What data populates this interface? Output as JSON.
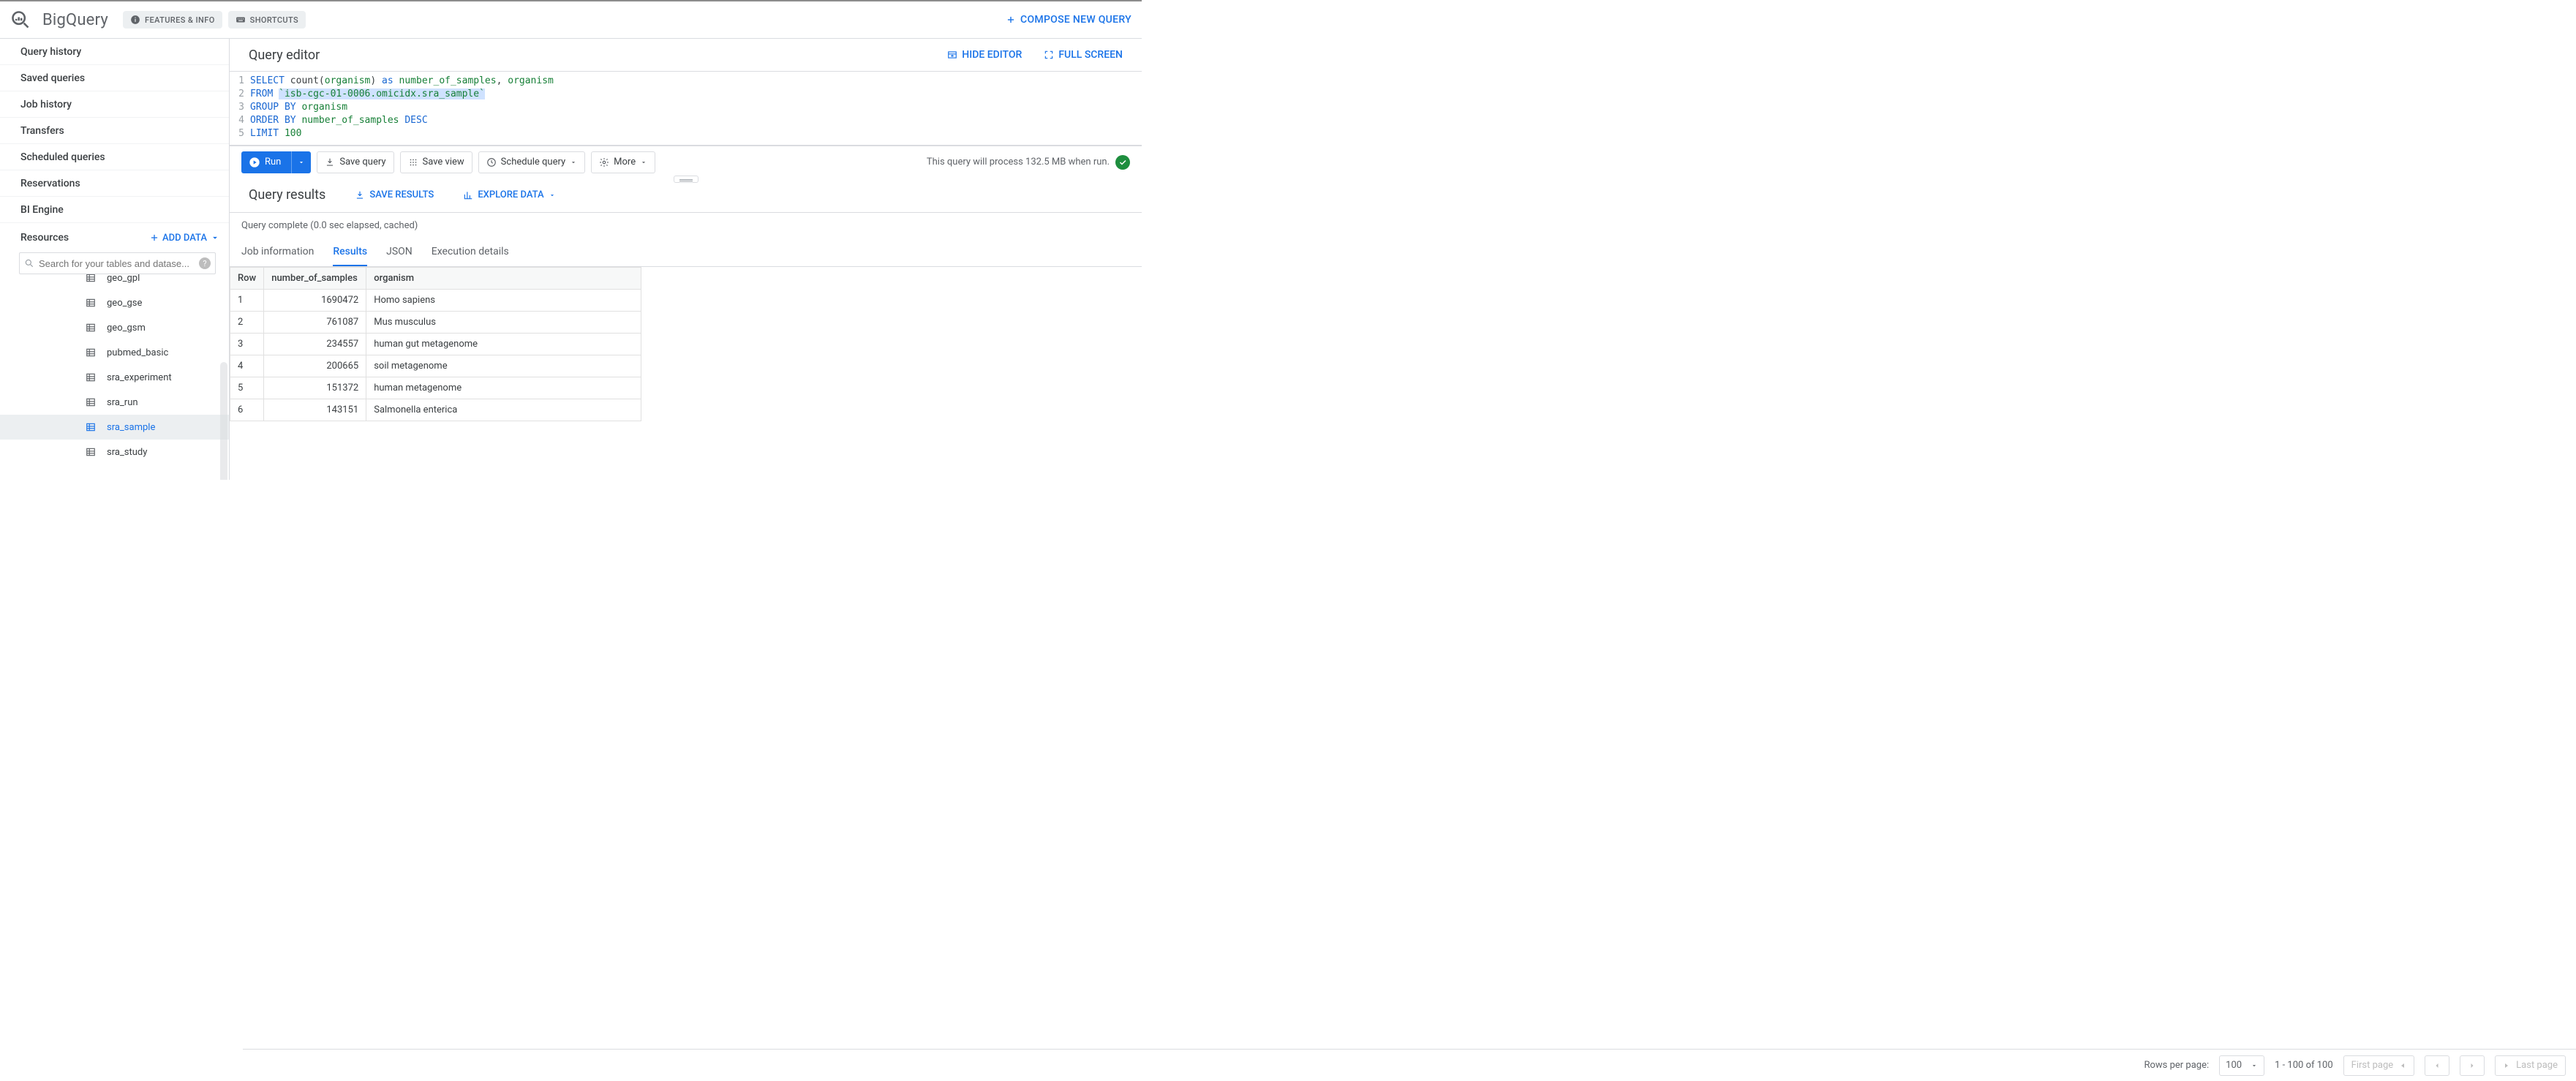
{
  "header": {
    "brand": "BigQuery",
    "features_info": "FEATURES & INFO",
    "shortcuts": "SHORTCUTS",
    "compose": "COMPOSE NEW QUERY"
  },
  "sidebar": {
    "nav": [
      "Query history",
      "Saved queries",
      "Job history",
      "Transfers",
      "Scheduled queries",
      "Reservations",
      "BI Engine"
    ],
    "resources_label": "Resources",
    "add_data": "ADD DATA",
    "search_placeholder": "Search for your tables and datase...",
    "tree_items": [
      {
        "label": "geo_gpl",
        "active": false,
        "cut": true
      },
      {
        "label": "geo_gse",
        "active": false
      },
      {
        "label": "geo_gsm",
        "active": false
      },
      {
        "label": "pubmed_basic",
        "active": false
      },
      {
        "label": "sra_experiment",
        "active": false
      },
      {
        "label": "sra_run",
        "active": false
      },
      {
        "label": "sra_sample",
        "active": true
      },
      {
        "label": "sra_study",
        "active": false
      }
    ]
  },
  "editor": {
    "title": "Query editor",
    "hide": "HIDE EDITOR",
    "fullscreen": "FULL SCREEN",
    "lines": {
      "l1a": "SELECT",
      "l1b": " count(",
      "l1c": "organism",
      "l1d": ") ",
      "l1e": "as",
      "l1f": " ",
      "l1g": "number_of_samples",
      "l1h": ", ",
      "l1i": "organism",
      "l2a": "FROM",
      "l2b": " ",
      "l2c": "`isb-cgc-01-0006.omicidx.sra_sample`",
      "l3a": "GROUP BY",
      "l3b": " ",
      "l3c": "organism",
      "l4a": "ORDER BY",
      "l4b": " ",
      "l4c": "number_of_samples",
      "l4d": " ",
      "l4e": "DESC",
      "l5a": "LIMIT",
      "l5b": " ",
      "l5c": "100"
    },
    "line_numbers": [
      "1",
      "2",
      "3",
      "4",
      "5"
    ]
  },
  "toolbar": {
    "run": "Run",
    "save_query": "Save query",
    "save_view": "Save view",
    "schedule": "Schedule query",
    "more": "More",
    "status": "This query will process 132.5 MB when run."
  },
  "results": {
    "title": "Query results",
    "save_results": "SAVE RESULTS",
    "explore": "EXPLORE DATA",
    "complete": "Query complete (0.0 sec elapsed, cached)",
    "tabs": [
      "Job information",
      "Results",
      "JSON",
      "Execution details"
    ],
    "active_tab": "Results",
    "columns": [
      "Row",
      "number_of_samples",
      "organism"
    ],
    "rows": [
      {
        "i": "1",
        "n": "1690472",
        "o": "Homo sapiens"
      },
      {
        "i": "2",
        "n": "761087",
        "o": "Mus musculus"
      },
      {
        "i": "3",
        "n": "234557",
        "o": "human gut metagenome"
      },
      {
        "i": "4",
        "n": "200665",
        "o": "soil metagenome"
      },
      {
        "i": "5",
        "n": "151372",
        "o": "human metagenome"
      },
      {
        "i": "6",
        "n": "143151",
        "o": "Salmonella enterica"
      }
    ]
  },
  "pager": {
    "rows_per_page": "Rows per page:",
    "page_size": "100",
    "range": "1 - 100 of 100",
    "first": "First page",
    "last": "Last page"
  }
}
